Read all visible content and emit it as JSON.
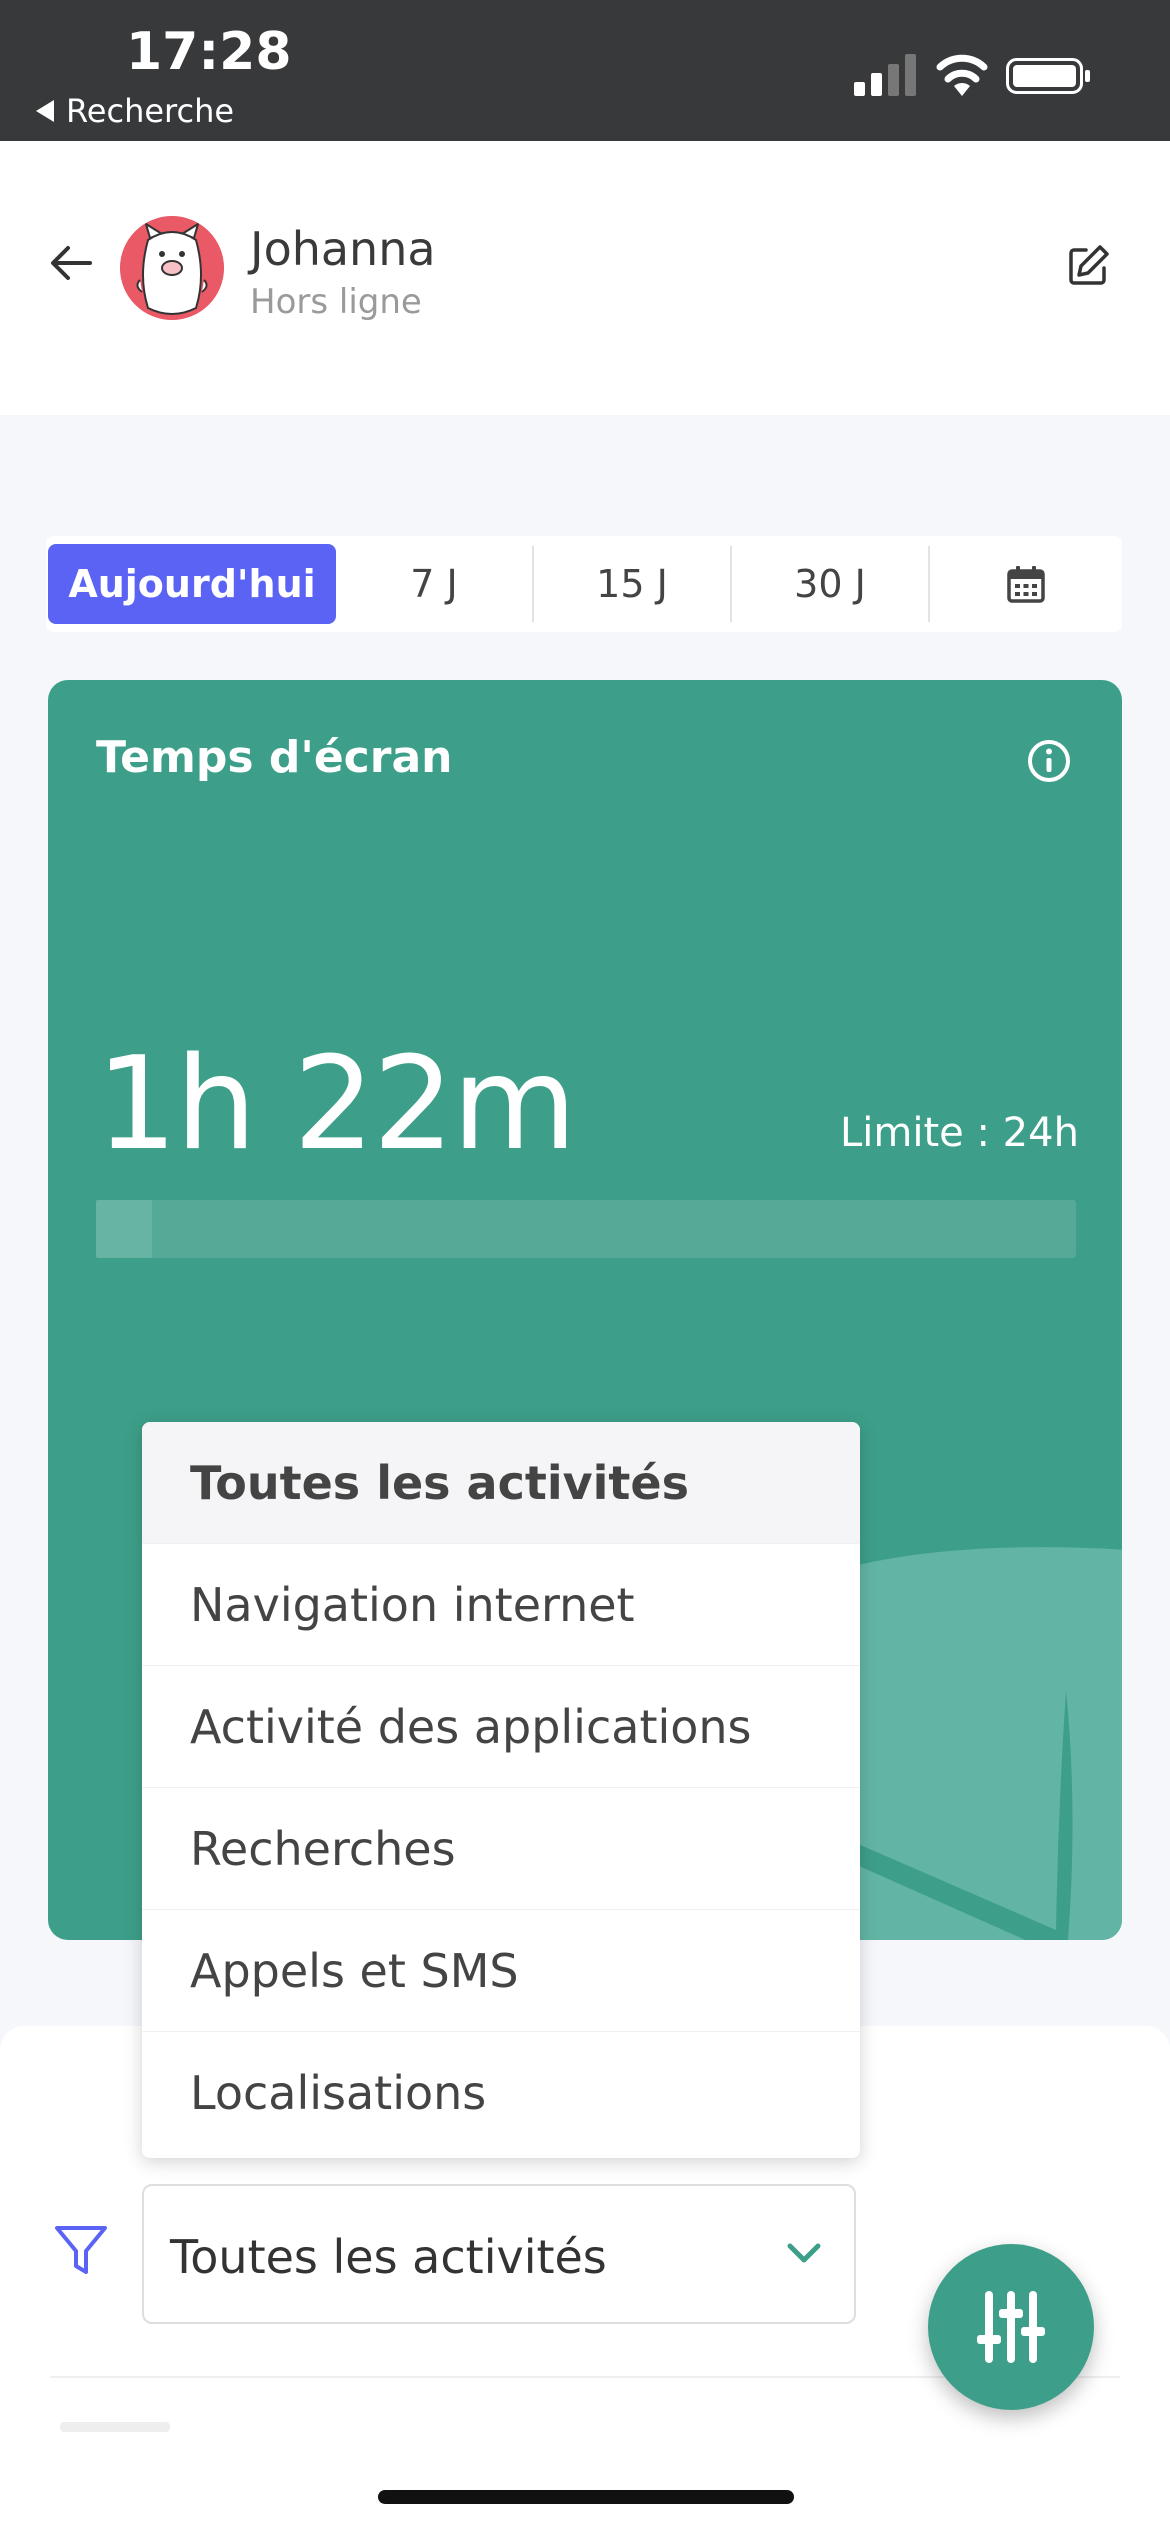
{
  "status_bar": {
    "time": "17:28",
    "back_label": "Recherche"
  },
  "header": {
    "name": "Johanna",
    "presence": "Hors ligne"
  },
  "tabs": [
    {
      "label": "Aujourd'hui",
      "active": true
    },
    {
      "label": "7 J",
      "active": false
    },
    {
      "label": "15 J",
      "active": false
    },
    {
      "label": "30 J",
      "active": false
    },
    {
      "icon": "calendar-icon",
      "active": false
    }
  ],
  "card": {
    "title": "Temps d'écran",
    "time": "1h 22m",
    "limit": "Limite : 24h",
    "usage_fraction": 0.057,
    "color": "#3d9f89"
  },
  "menu": {
    "items": [
      {
        "label": "Toutes les activités",
        "selected": true
      },
      {
        "label": "Navigation internet",
        "selected": false
      },
      {
        "label": "Activité des applications",
        "selected": false
      },
      {
        "label": "Recherches",
        "selected": false
      },
      {
        "label": "Appels et SMS",
        "selected": false
      },
      {
        "label": "Localisations",
        "selected": false
      }
    ]
  },
  "filter": {
    "selected": "Toutes les activités",
    "icon": "filter-icon"
  },
  "colors": {
    "accent": "#5b63f5",
    "primary": "#3d9f89"
  }
}
